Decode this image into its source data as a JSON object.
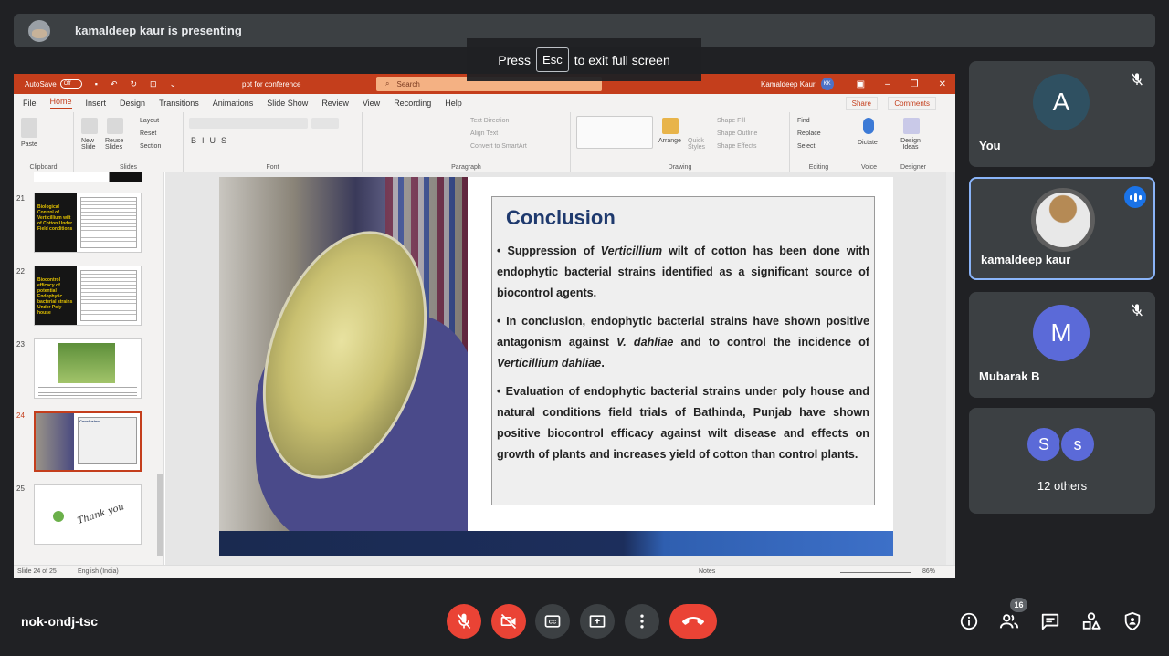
{
  "presenter": {
    "name_text": "kamaldeep kaur is presenting"
  },
  "fullscreen_toast": {
    "prefix": "Press",
    "key": "Esc",
    "suffix": "to exit full screen"
  },
  "powerpoint": {
    "autosave_label": "AutoSave",
    "autosave_state": "Off",
    "document_name": "ppt for conference",
    "search_placeholder": "Search",
    "user_name": "Kamaldeep Kaur",
    "user_initials": "KK",
    "tabs": [
      "File",
      "Home",
      "Insert",
      "Design",
      "Transitions",
      "Animations",
      "Slide Show",
      "Review",
      "View",
      "Recording",
      "Help"
    ],
    "active_tab": "Home",
    "share_label": "Share",
    "comments_label": "Comments",
    "ribbon_groups": {
      "clipboard": "Clipboard",
      "slides": "Slides",
      "font": "Font",
      "paragraph": "Paragraph",
      "drawing": "Drawing",
      "editing": "Editing",
      "voice": "Voice",
      "designer": "Designer"
    },
    "ribbon_buttons": {
      "paste": "Paste",
      "new_slide": "New Slide",
      "reuse_slides": "Reuse Slides",
      "layout": "Layout",
      "reset": "Reset",
      "section": "Section",
      "text_direction": "Text Direction",
      "align_text": "Align Text",
      "convert_smartart": "Convert to SmartArt",
      "arrange": "Arrange",
      "quick_styles": "Quick Styles",
      "shape_fill": "Shape Fill",
      "shape_outline": "Shape Outline",
      "shape_effects": "Shape Effects",
      "find": "Find",
      "replace": "Replace",
      "select": "Select",
      "dictate": "Dictate",
      "design_ideas": "Design Ideas"
    },
    "thumbnails": [
      {
        "number": "21",
        "title": "Biological Control of Verticillium wilt of Cotton Under Field conditions"
      },
      {
        "number": "22",
        "title": "Biocontrol efficacy of potential Endophytic bacterial strains Under Poly house"
      },
      {
        "number": "23",
        "title": ""
      },
      {
        "number": "24",
        "title": "Conclusion"
      },
      {
        "number": "25",
        "title": "Thank you"
      }
    ],
    "status": {
      "slide_info": "Slide 24 of 25",
      "language": "English (India)",
      "notes_label": "Notes",
      "zoom": "86%"
    }
  },
  "slide": {
    "title": "Conclusion",
    "bullets": [
      {
        "parts": [
          "• Suppression of ",
          "Verticillium",
          " wilt of cotton has been done with endophytic bacterial strains identified as a significant source of biocontrol agents."
        ]
      },
      {
        "parts": [
          "• In conclusion, endophytic bacterial strains have shown positive antagonism against ",
          "V. dahliae",
          " and to control the incidence of ",
          "Verticillium dahliae",
          "."
        ]
      },
      {
        "parts": [
          "• Evaluation of endophytic bacterial strains under poly house and natural conditions field trials of Bathinda, Punjab have shown positive biocontrol efficacy against wilt disease and effects on growth of plants and increases yield of cotton than control plants."
        ]
      }
    ]
  },
  "participants": [
    {
      "name": "You",
      "initial": "A",
      "color": "#2f5061",
      "muted": true
    },
    {
      "name": "kamaldeep kaur",
      "initial": "",
      "color": "#6b6b6b",
      "muted": false,
      "speaking": true
    },
    {
      "name": "Mubarak B",
      "initial": "M",
      "color": "#5b6ad8",
      "muted": true
    },
    {
      "name": "12 others",
      "initials": [
        "S",
        "s"
      ],
      "colors": [
        "#5b6ad8",
        "#5b6ad8"
      ]
    }
  ],
  "meeting": {
    "code": "nok-ondj-tsc",
    "participant_count": "16"
  },
  "icons": {
    "mic": "mic-off-icon",
    "camera": "camera-off-icon",
    "captions": "closed-captions-icon",
    "present": "present-screen-icon",
    "more": "more-options-icon",
    "end_call": "end-call-icon",
    "info": "info-icon",
    "people": "people-icon",
    "chat": "chat-icon",
    "activities": "activities-icon",
    "host_controls": "host-controls-icon"
  }
}
